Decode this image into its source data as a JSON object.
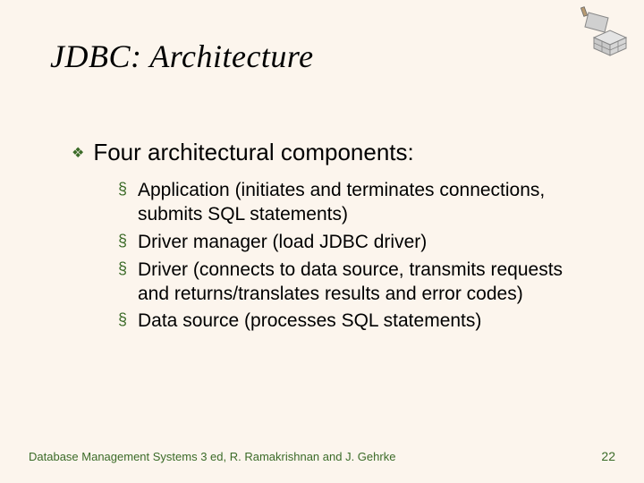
{
  "title": "JDBC: Architecture",
  "lead_bullet": "❖",
  "lead_text": "Four architectural components:",
  "items": [
    "Application (initiates and terminates connections, submits SQL statements)",
    "Driver manager (load JDBC driver)",
    "Driver (connects to data source, transmits requests and returns/translates results and error codes)",
    "Data source (processes SQL statements)"
  ],
  "footer_left": "Database Management Systems 3 ed,  R. Ramakrishnan and J. Gehrke",
  "footer_right": "22"
}
